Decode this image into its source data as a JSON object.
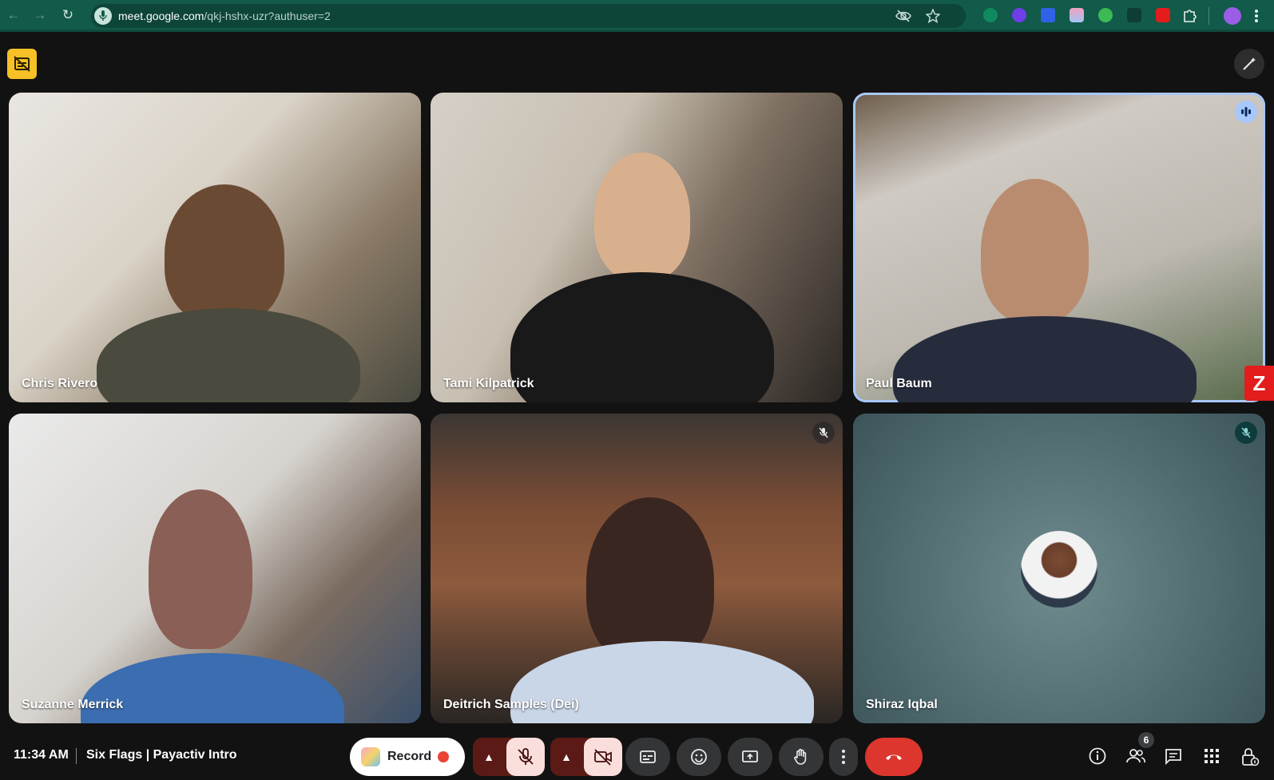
{
  "browser": {
    "url_host": "meet.google.com",
    "url_path": "/qkj-hshx-uzr?authuser=2",
    "icons": [
      "back-icon",
      "forward-icon",
      "reload-icon",
      "mic-permission-icon",
      "eye-off-icon",
      "star-icon",
      "extensions-icon",
      "profile-avatar"
    ]
  },
  "participants": [
    {
      "name": "Chris Rivero"
    },
    {
      "name": "Tami Kilpatrick"
    },
    {
      "name": "Paul Baum",
      "speaking": true
    },
    {
      "name": "Suzanne Merrick"
    },
    {
      "name": "Deitrich Samples (Dei)",
      "muted": true
    },
    {
      "name": "Shiraz Iqbal",
      "muted": true,
      "camera_off": true
    }
  ],
  "footer": {
    "time": "11:34 AM",
    "separator": "|",
    "meeting_title": "Six Flags | Payactiv Intro",
    "record_label": "Record",
    "people_count": "6"
  },
  "colors": {
    "chrome_bg": "#125a4a",
    "meet_bg": "#121212",
    "active_border": "#a8c7fa",
    "end_call": "#dc362e",
    "muted_control": "#f9dedc",
    "record_dot": "#ea4335"
  }
}
